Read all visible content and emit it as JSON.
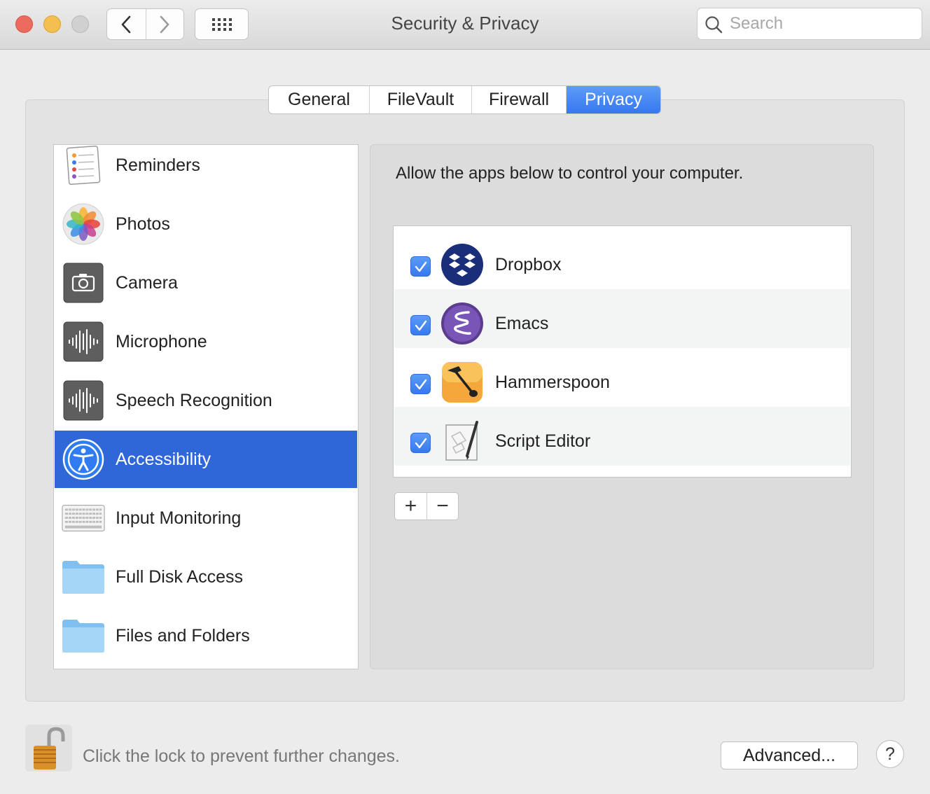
{
  "window": {
    "title": "Security & Privacy",
    "search_placeholder": "Search"
  },
  "tabs": [
    {
      "label": "General",
      "active": false
    },
    {
      "label": "FileVault",
      "active": false
    },
    {
      "label": "Firewall",
      "active": false
    },
    {
      "label": "Privacy",
      "active": true
    }
  ],
  "categories": [
    {
      "label": "Reminders",
      "icon": "reminders-icon"
    },
    {
      "label": "Photos",
      "icon": "photos-icon"
    },
    {
      "label": "Camera",
      "icon": "camera-icon"
    },
    {
      "label": "Microphone",
      "icon": "microphone-icon"
    },
    {
      "label": "Speech Recognition",
      "icon": "speech-recognition-icon"
    },
    {
      "label": "Accessibility",
      "icon": "accessibility-icon",
      "selected": true
    },
    {
      "label": "Input Monitoring",
      "icon": "keyboard-icon"
    },
    {
      "label": "Full Disk Access",
      "icon": "folder-icon"
    },
    {
      "label": "Files and Folders",
      "icon": "folder-icon"
    }
  ],
  "panel": {
    "heading": "Allow the apps below to control your computer.",
    "apps": [
      {
        "name": "Dropbox",
        "checked": true,
        "icon": "dropbox-icon"
      },
      {
        "name": "Emacs",
        "checked": true,
        "icon": "emacs-icon"
      },
      {
        "name": "Hammerspoon",
        "checked": true,
        "icon": "hammerspoon-icon"
      },
      {
        "name": "Script Editor",
        "checked": true,
        "icon": "script-editor-icon"
      }
    ],
    "add_symbol": "+",
    "remove_symbol": "−"
  },
  "footer": {
    "lock_text": "Click the lock to prevent further changes.",
    "advanced_label": "Advanced...",
    "help_label": "?"
  },
  "colors": {
    "accent": "#3677f0",
    "selection": "#2f66d8"
  }
}
